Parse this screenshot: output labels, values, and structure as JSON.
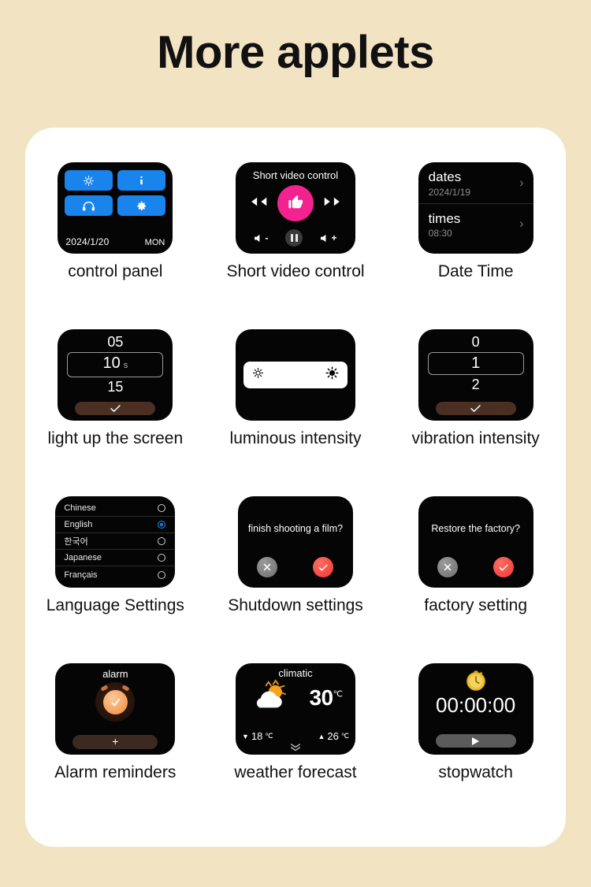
{
  "page": {
    "title": "More applets"
  },
  "theme": {
    "background": "#f2e3c3",
    "panel": "#ffffff",
    "screen": "#050505",
    "accent_blue": "#1884ec",
    "accent_pink": "#f4228f",
    "accent_red": "#f0392f",
    "accent_brown": "#4a2f22",
    "accent_orange": "#f08a3c"
  },
  "applets": [
    {
      "id": "control-panel",
      "caption": "control panel",
      "buttons": [
        "brightness-icon",
        "info-icon",
        "bluetooth-headphones-icon",
        "gear-icon"
      ],
      "date": "2024/1/20",
      "weekday": "MON"
    },
    {
      "id": "short-video-control",
      "caption": "Short video control",
      "screen_title": "Short video control",
      "controls": [
        "rewind-icon",
        "thumbs-up-icon",
        "fast-forward-icon",
        "volume-down-icon",
        "pause-icon",
        "volume-up-icon"
      ],
      "volume_down_label": "-",
      "volume_up_label": "+"
    },
    {
      "id": "date-time",
      "caption": "Date Time",
      "rows": [
        {
          "label": "dates",
          "value": "2024/1/19"
        },
        {
          "label": "times",
          "value": "08:30"
        }
      ],
      "chevron": "›"
    },
    {
      "id": "light-up-screen",
      "caption": "light up the screen",
      "options": [
        "05",
        "10",
        "15"
      ],
      "selected": "10",
      "unit": "s",
      "confirm": "check-icon"
    },
    {
      "id": "luminous-intensity",
      "caption": "luminous intensity",
      "slider": {
        "min_icon": "sun-low-icon",
        "max_icon": "sun-high-icon"
      }
    },
    {
      "id": "vibration-intensity",
      "caption": "vibration intensity",
      "options": [
        "0",
        "1",
        "2"
      ],
      "selected": "1",
      "confirm": "check-icon"
    },
    {
      "id": "language-settings",
      "caption": "Language Settings",
      "languages": [
        {
          "label": "Chinese",
          "selected": false
        },
        {
          "label": "English",
          "selected": true
        },
        {
          "label": "한국어",
          "selected": false
        },
        {
          "label": "Japanese",
          "selected": false
        },
        {
          "label": "Français",
          "selected": false
        }
      ]
    },
    {
      "id": "shutdown-settings",
      "caption": "Shutdown settings",
      "question": "finish shooting a film?",
      "cancel": "close-icon",
      "confirm": "check-icon"
    },
    {
      "id": "factory-setting",
      "caption": "factory setting",
      "question": "Restore the factory?",
      "cancel": "close-icon",
      "confirm": "check-icon"
    },
    {
      "id": "alarm-reminders",
      "caption": "Alarm reminders",
      "screen_title": "alarm",
      "icon": "alarm-clock-icon",
      "add_label": "+"
    },
    {
      "id": "weather-forecast",
      "caption": "weather forecast",
      "screen_title": "climatic",
      "icon": "sun-behind-cloud-icon",
      "current_temp": "30",
      "unit": "℃",
      "low": "18",
      "high": "26",
      "low_arrow": "▼",
      "high_arrow": "▲",
      "expand": "»"
    },
    {
      "id": "stopwatch",
      "caption": "stopwatch",
      "icon": "stopwatch-icon",
      "time": "00:00:00",
      "action": "play-icon"
    }
  ]
}
